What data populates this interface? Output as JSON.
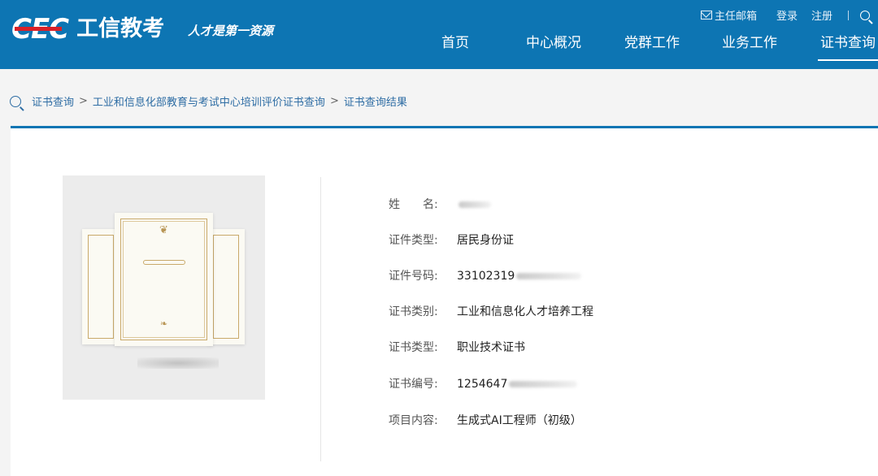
{
  "header": {
    "logo_mark": "CEC",
    "logo_name": "工信教考",
    "slogan": "人才是第一资源",
    "top_links": {
      "mail": "主任邮箱",
      "login": "登录",
      "register": "注册"
    },
    "nav": [
      "首页",
      "中心概况",
      "党群工作",
      "业务工作",
      "证书查询"
    ],
    "active_nav": "证书查询",
    "colors": {
      "brand_blue": "#0d75b3",
      "logo_red": "#d92128"
    }
  },
  "breadcrumb": {
    "items": [
      "证书查询",
      "工业和信息化部教育与考试中心培训评价证书查询",
      "证书查询结果"
    ],
    "separator": ">"
  },
  "result": {
    "name_label": "姓　　名:",
    "name_value": "",
    "id_type_label": "证件类型:",
    "id_type_value": "居民身份证",
    "id_number_label": "证件号码:",
    "id_number_value": "33102319",
    "cert_category_label": "证书类别:",
    "cert_category_value": "工业和信息化人才培养工程",
    "cert_type_label": "证书类型:",
    "cert_type_value": "职业技术证书",
    "cert_number_label": "证书编号:",
    "cert_number_value": "1254647",
    "project_label": "项目内容:",
    "project_value": "生成式AI工程师（初级）"
  }
}
